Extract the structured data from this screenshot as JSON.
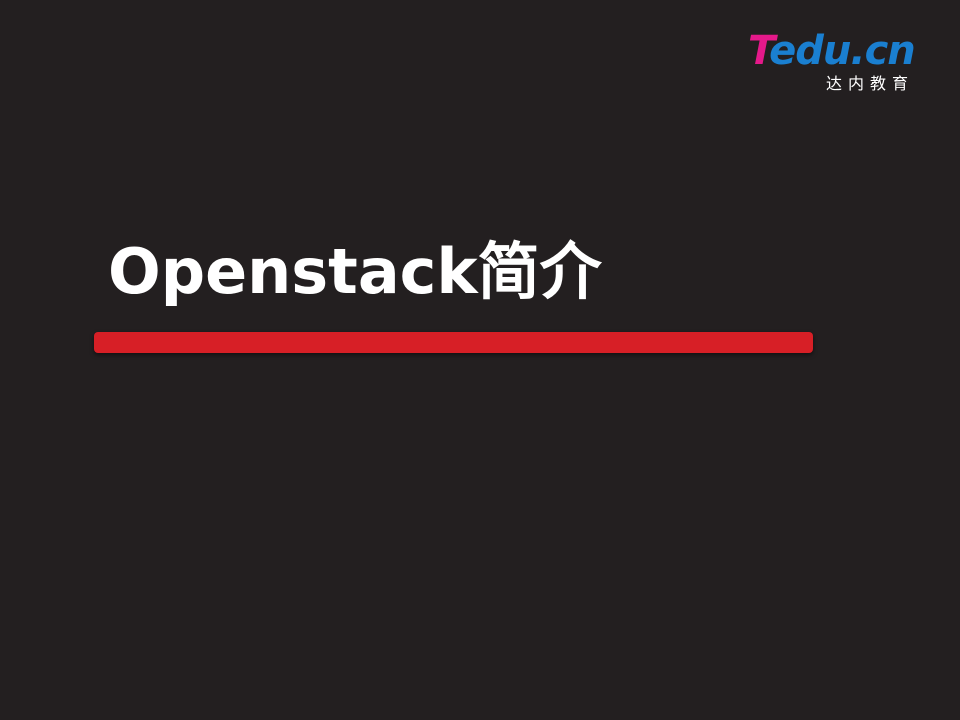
{
  "logo": {
    "mark_t": "T",
    "mark_rest": "edu.cn",
    "subtitle": "达内教育",
    "colors": {
      "t": "#e5198a",
      "rest": "#1a7fd0"
    }
  },
  "slide": {
    "title": "Openstack简介",
    "background": "#231f20",
    "accent_bar_color": "#d71f26"
  }
}
